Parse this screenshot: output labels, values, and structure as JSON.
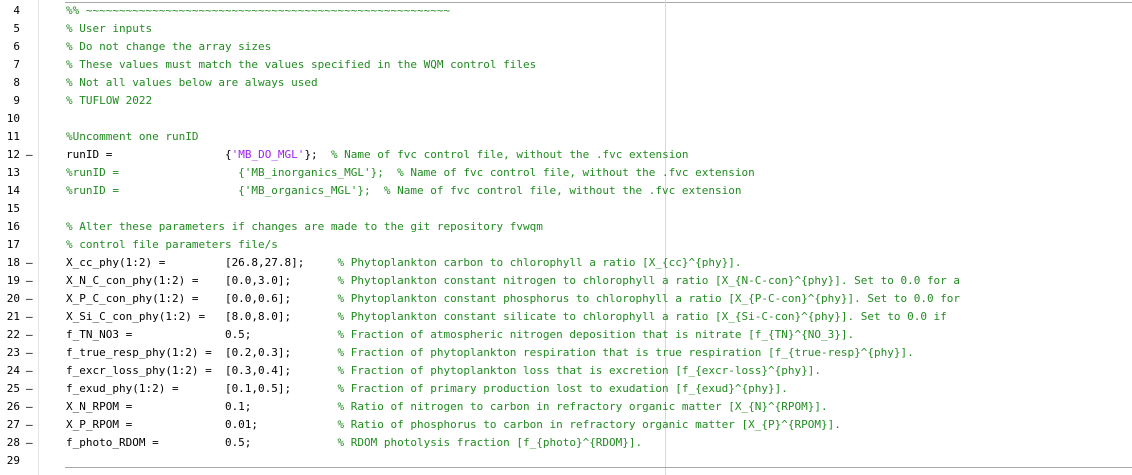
{
  "colors": {
    "comment": "#228B22",
    "string": "#A020F0",
    "code": "#000000"
  },
  "lines": [
    {
      "num": "4",
      "marker": "",
      "code": "",
      "comment": "%% ~~~~~~~~~~~~~~~~~~~~~~~~~~~~~~~~~~~~~~~~~~~~~~~~~~~~~~~"
    },
    {
      "num": "5",
      "marker": "",
      "code": "",
      "comment": "% User inputs"
    },
    {
      "num": "6",
      "marker": "",
      "code": "",
      "comment": "% Do not change the array sizes"
    },
    {
      "num": "7",
      "marker": "",
      "code": "",
      "comment": "% These values must match the values specified in the WQM control files"
    },
    {
      "num": "8",
      "marker": "",
      "code": "",
      "comment": "% Not all values below are always used"
    },
    {
      "num": "9",
      "marker": "",
      "code": "",
      "comment": "% TUFLOW 2022"
    },
    {
      "num": "10",
      "marker": "",
      "code": "",
      "comment": ""
    },
    {
      "num": "11",
      "marker": "",
      "code": "",
      "comment": "%Uncomment one runID"
    },
    {
      "num": "12",
      "marker": "–",
      "code": "runID =                 {",
      "string": "'MB_DO_MGL'",
      "after": "};  ",
      "comment": "% Name of fvc control file, without the .fvc extension"
    },
    {
      "num": "13",
      "marker": "",
      "code": "",
      "comment": "%runID =                  {'MB_inorganics_MGL'};  % Name of fvc control file, without the .fvc extension"
    },
    {
      "num": "14",
      "marker": "",
      "code": "",
      "comment": "%runID =                  {'MB_organics_MGL'};  % Name of fvc control file, without the .fvc extension"
    },
    {
      "num": "15",
      "marker": "",
      "code": "",
      "comment": ""
    },
    {
      "num": "16",
      "marker": "",
      "code": "",
      "comment": "% Alter these parameters if changes are made to the git repository fvwqm"
    },
    {
      "num": "17",
      "marker": "",
      "code": "",
      "comment": "% control file parameters file/s"
    },
    {
      "num": "18",
      "marker": "–",
      "code": "X_cc_phy(1:2) =         [26.8,27.8];     ",
      "comment": "% Phytoplankton carbon to chlorophyll a ratio [X_{cc}^{phy}]."
    },
    {
      "num": "19",
      "marker": "–",
      "code": "X_N_C_con_phy(1:2) =    [0.0,3.0];       ",
      "comment": "% Phytoplankton constant nitrogen to chlorophyll a ratio [X_{N-C-con}^{phy}]. Set to 0.0 for a"
    },
    {
      "num": "20",
      "marker": "–",
      "code": "X_P_C_con_phy(1:2) =    [0.0,0.6];       ",
      "comment": "% Phytoplankton constant phosphorus to chlorophyll a ratio [X_{P-C-con}^{phy}]. Set to 0.0 for"
    },
    {
      "num": "21",
      "marker": "–",
      "code": "X_Si_C_con_phy(1:2) =   [8.0,8.0];       ",
      "comment": "% Phytoplankton constant silicate to chlorophyll a ratio [X_{Si-C-con}^{phy}]. Set to 0.0 if"
    },
    {
      "num": "22",
      "marker": "–",
      "code": "f_TN_NO3 =              0.5;             ",
      "comment": "% Fraction of atmospheric nitrogen deposition that is nitrate [f_{TN}^{NO_3}]."
    },
    {
      "num": "23",
      "marker": "–",
      "code": "f_true_resp_phy(1:2) =  [0.2,0.3];       ",
      "comment": "% Fraction of phytoplankton respiration that is true respiration [f_{true-resp}^{phy}]."
    },
    {
      "num": "24",
      "marker": "–",
      "code": "f_excr_loss_phy(1:2) =  [0.3,0.4];       ",
      "comment": "% Fraction of phytoplankton loss that is excretion [f_{excr-loss}^{phy}]."
    },
    {
      "num": "25",
      "marker": "–",
      "code": "f_exud_phy(1:2) =       [0.1,0.5];       ",
      "comment": "% Fraction of primary production lost to exudation [f_{exud}^{phy}]."
    },
    {
      "num": "26",
      "marker": "–",
      "code": "X_N_RPOM =              0.1;             ",
      "comment": "% Ratio of nitrogen to carbon in refractory organic matter [X_{N}^{RPOM}]."
    },
    {
      "num": "27",
      "marker": "–",
      "code": "X_P_RPOM =              0.01;            ",
      "comment": "% Ratio of phosphorus to carbon in refractory organic matter [X_{P}^{RPOM}]."
    },
    {
      "num": "28",
      "marker": "–",
      "code": "f_photo_RDOM =          0.5;             ",
      "comment": "% RDOM photolysis fraction [f_{photo}^{RDOM}]."
    },
    {
      "num": "29",
      "marker": "",
      "code": "",
      "comment": ""
    }
  ]
}
